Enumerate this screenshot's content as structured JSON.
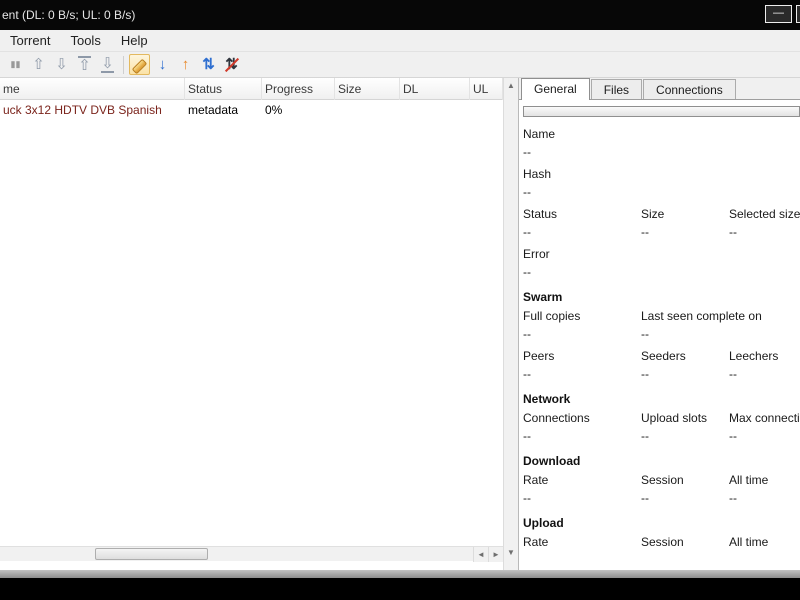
{
  "window": {
    "title": "ent (DL: 0 B/s; UL: 0 B/s)",
    "minimize_glyph": "—"
  },
  "menu": {
    "items": [
      {
        "label": "Torrent"
      },
      {
        "label": "Tools"
      },
      {
        "label": "Help"
      }
    ]
  },
  "toolbar": {
    "buttons": [
      {
        "name": "pause-button",
        "icon": "pause-icon",
        "glyph": "▮▮",
        "color": "#999999",
        "size": "9px"
      },
      {
        "name": "move-up-button",
        "icon": "arrow-up-icon",
        "glyph": "⇧",
        "color": "#8e99a8"
      },
      {
        "name": "move-down-button",
        "icon": "arrow-down-icon",
        "glyph": "⇩",
        "color": "#8e99a8"
      },
      {
        "name": "move-top-button",
        "icon": "arrow-to-top-icon",
        "glyph": "⇧",
        "color": "#8e99a8",
        "bar": "top"
      },
      {
        "name": "move-bottom-button",
        "icon": "arrow-to-bottom-icon",
        "glyph": "⇩",
        "color": "#8e99a8",
        "bar": "bottom"
      },
      {
        "type": "separator"
      },
      {
        "name": "wrench-button",
        "icon": "wrench-icon",
        "glyph": "",
        "color": "#dd9a2f",
        "highlighted": true
      },
      {
        "name": "download-limit-button",
        "icon": "download-arrow-icon",
        "glyph": "↓",
        "color": "#2f6fd0",
        "bold": true
      },
      {
        "name": "upload-limit-button",
        "icon": "upload-arrow-icon",
        "glyph": "↑",
        "color": "#e8882a",
        "bold": true
      },
      {
        "name": "transfer-button",
        "icon": "swap-arrows-icon",
        "glyph": "⇅",
        "color": "#2f6fd0",
        "bold": true
      },
      {
        "name": "disconnect-button",
        "icon": "no-connection-icon",
        "glyph": "⇅",
        "color": "#30353d",
        "bold": true,
        "slash": true
      }
    ]
  },
  "torrent_list": {
    "name_color": "#7b241c",
    "columns": [
      {
        "key": "name",
        "label": "me"
      },
      {
        "key": "status",
        "label": "Status"
      },
      {
        "key": "progress",
        "label": "Progress"
      },
      {
        "key": "size",
        "label": "Size"
      },
      {
        "key": "dl",
        "label": "DL"
      },
      {
        "key": "ul",
        "label": "UL"
      }
    ],
    "rows": [
      {
        "cells": [
          "uck 3x12 HDTV DVB Spanish",
          "metadata",
          "0%",
          "",
          "",
          ""
        ]
      }
    ]
  },
  "scrollbars": {
    "up_arrow": "▲",
    "down_arrow": "▼",
    "left_arrow": "◄",
    "right_arrow": "►"
  },
  "details": {
    "tabs": [
      {
        "label": "General",
        "active": true
      },
      {
        "label": "Files",
        "active": false
      },
      {
        "label": "Connections",
        "active": false
      }
    ],
    "general": {
      "sections": [
        {
          "title": "",
          "rows": [
            [
              {
                "label": "Name",
                "value": "--"
              }
            ],
            [
              {
                "label": "Hash",
                "value": "--"
              }
            ],
            [
              {
                "label": "Status",
                "value": "--"
              },
              {
                "label": "Size",
                "value": "--"
              },
              {
                "label": "Selected size",
                "value": "--"
              }
            ],
            [
              {
                "label": "Error",
                "value": "--"
              }
            ]
          ]
        },
        {
          "title": "Swarm",
          "rows": [
            [
              {
                "label": "Full copies",
                "value": "--"
              },
              {
                "label": "Last seen complete on",
                "value": "--"
              }
            ],
            [
              {
                "label": "Peers",
                "value": "--"
              },
              {
                "label": "Seeders",
                "value": "--"
              },
              {
                "label": "Leechers",
                "value": "--"
              }
            ]
          ]
        },
        {
          "title": "Network",
          "rows": [
            [
              {
                "label": "Connections",
                "value": "--"
              },
              {
                "label": "Upload slots",
                "value": "--"
              },
              {
                "label": "Max connectio",
                "value": "--"
              }
            ]
          ]
        },
        {
          "title": "Download",
          "rows": [
            [
              {
                "label": "Rate",
                "value": "--"
              },
              {
                "label": "Session",
                "value": "--"
              },
              {
                "label": "All time",
                "value": "--"
              }
            ]
          ]
        },
        {
          "title": "Upload",
          "rows": [
            [
              {
                "label": "Rate",
                "value": ""
              },
              {
                "label": "Session",
                "value": ""
              },
              {
                "label": "All time",
                "value": ""
              }
            ]
          ]
        }
      ]
    }
  }
}
